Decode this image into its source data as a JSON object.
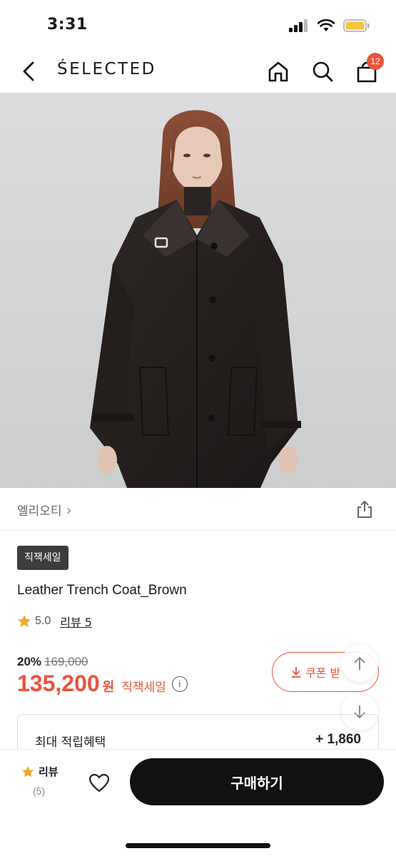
{
  "status": {
    "time": "3:31"
  },
  "nav": {
    "title": "ŚELECTED",
    "cart_count": "12"
  },
  "brand": {
    "name": "엘리오티",
    "chevron": "›"
  },
  "product": {
    "tag": "직잭세일",
    "name": "Leather Trench Coat_Brown",
    "rating": "5.0",
    "review_label": "리뷰 5",
    "discount_rate": "20%",
    "original_price": "169,000",
    "sale_price": "135,200",
    "currency": "원",
    "sale_label": "직잭세일",
    "info": "i"
  },
  "coupon": {
    "label": "쿠폰 받"
  },
  "points": {
    "label": "최대 적립혜택",
    "value": "+ 1,860"
  },
  "bottom": {
    "review_label": "리뷰",
    "review_count": "(5)",
    "buy_label": "구매하기"
  },
  "colors": {
    "accent": "#e8553c",
    "star": "#f5a623",
    "buy_bg": "#111111"
  },
  "icons": [
    "back-icon",
    "home-icon",
    "search-icon",
    "cart-icon",
    "share-icon",
    "star-icon",
    "download-icon",
    "arrow-up-icon",
    "arrow-down-icon",
    "heart-icon"
  ]
}
